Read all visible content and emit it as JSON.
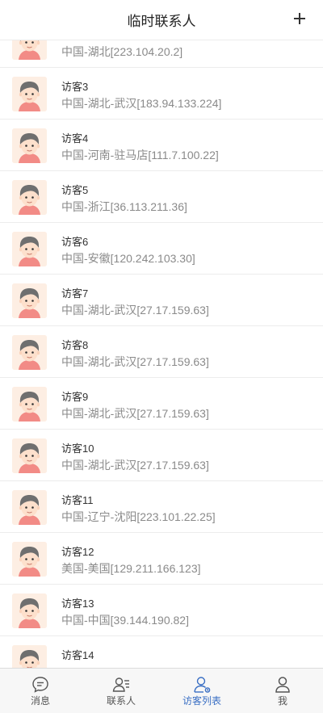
{
  "header": {
    "title": "临时联系人",
    "add_icon": "plus-icon"
  },
  "visitors": [
    {
      "name": "访客2",
      "location": "中国-湖北[223.104.20.2]"
    },
    {
      "name": "访客3",
      "location": "中国-湖北-武汉[183.94.133.224]"
    },
    {
      "name": "访客4",
      "location": "中国-河南-驻马店[111.7.100.22]"
    },
    {
      "name": "访客5",
      "location": "中国-浙江[36.113.211.36]"
    },
    {
      "name": "访客6",
      "location": "中国-安徽[120.242.103.30]"
    },
    {
      "name": "访客7",
      "location": "中国-湖北-武汉[27.17.159.63]"
    },
    {
      "name": "访客8",
      "location": "中国-湖北-武汉[27.17.159.63]"
    },
    {
      "name": "访客9",
      "location": "中国-湖北-武汉[27.17.159.63]"
    },
    {
      "name": "访客10",
      "location": "中国-湖北-武汉[27.17.159.63]"
    },
    {
      "name": "访客11",
      "location": "中国-辽宁-沈阳[223.101.22.25]"
    },
    {
      "name": "访客12",
      "location": "美国-美国[129.211.166.123]"
    },
    {
      "name": "访客13",
      "location": "中国-中国[39.144.190.82]"
    },
    {
      "name": "访客14",
      "location": ""
    }
  ],
  "tabbar": {
    "tabs": [
      {
        "label": "消息",
        "icon": "message-icon"
      },
      {
        "label": "联系人",
        "icon": "contacts-icon"
      },
      {
        "label": "访客列表",
        "icon": "visitor-list-icon"
      },
      {
        "label": "我",
        "icon": "profile-icon"
      }
    ],
    "active_index": 2
  },
  "colors": {
    "accent": "#3a6fc4",
    "inactive": "#555555",
    "avatar_bg": "#fdeee3"
  }
}
